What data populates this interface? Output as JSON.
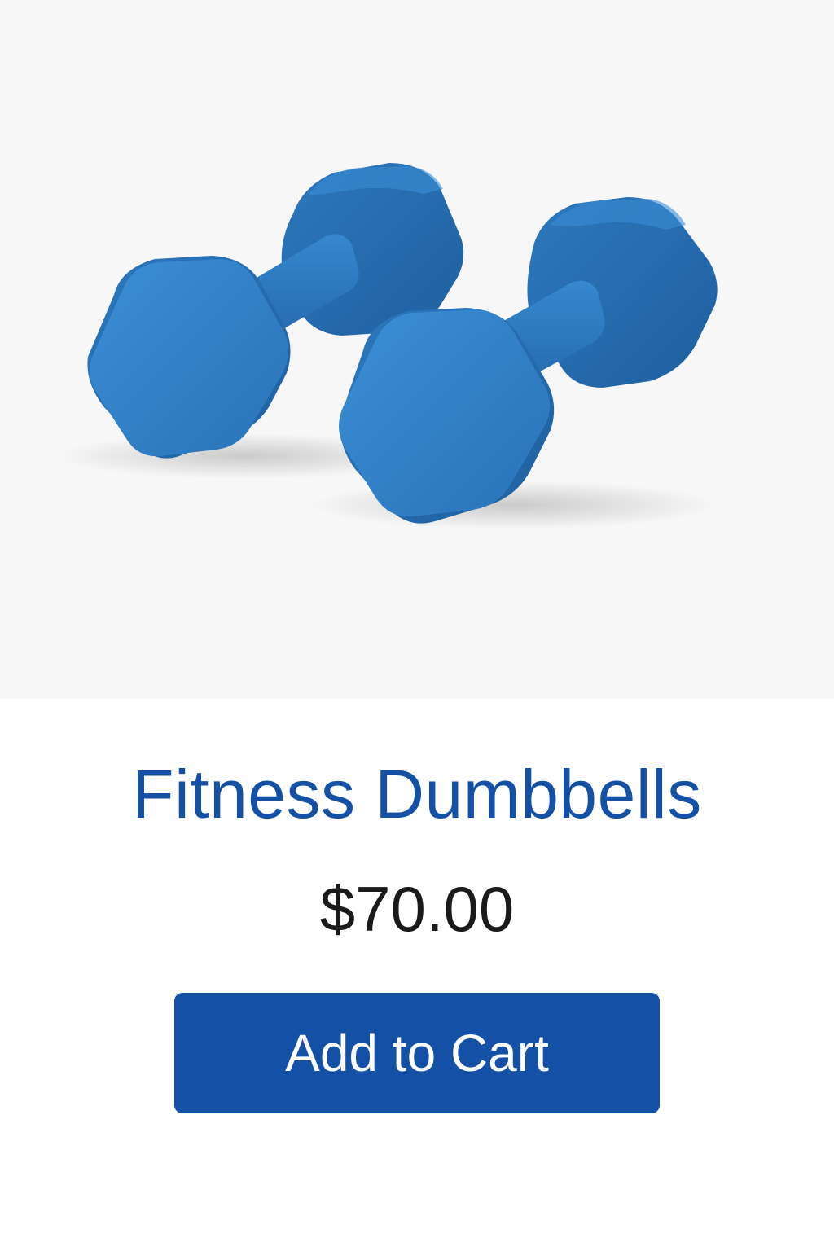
{
  "product": {
    "image_alt": "Pair of blue hexagonal fitness dumbbells",
    "name": "Fitness Dumbbells",
    "price": "$70.00",
    "add_to_cart_label": "Add to Cart"
  },
  "colors": {
    "brand_blue": "#1450a6",
    "dumbbell_blue": "#2e7bc4",
    "price_text": "#1a1a1a",
    "hero_background": "#f7f7f7",
    "button_text": "#ffffff"
  }
}
